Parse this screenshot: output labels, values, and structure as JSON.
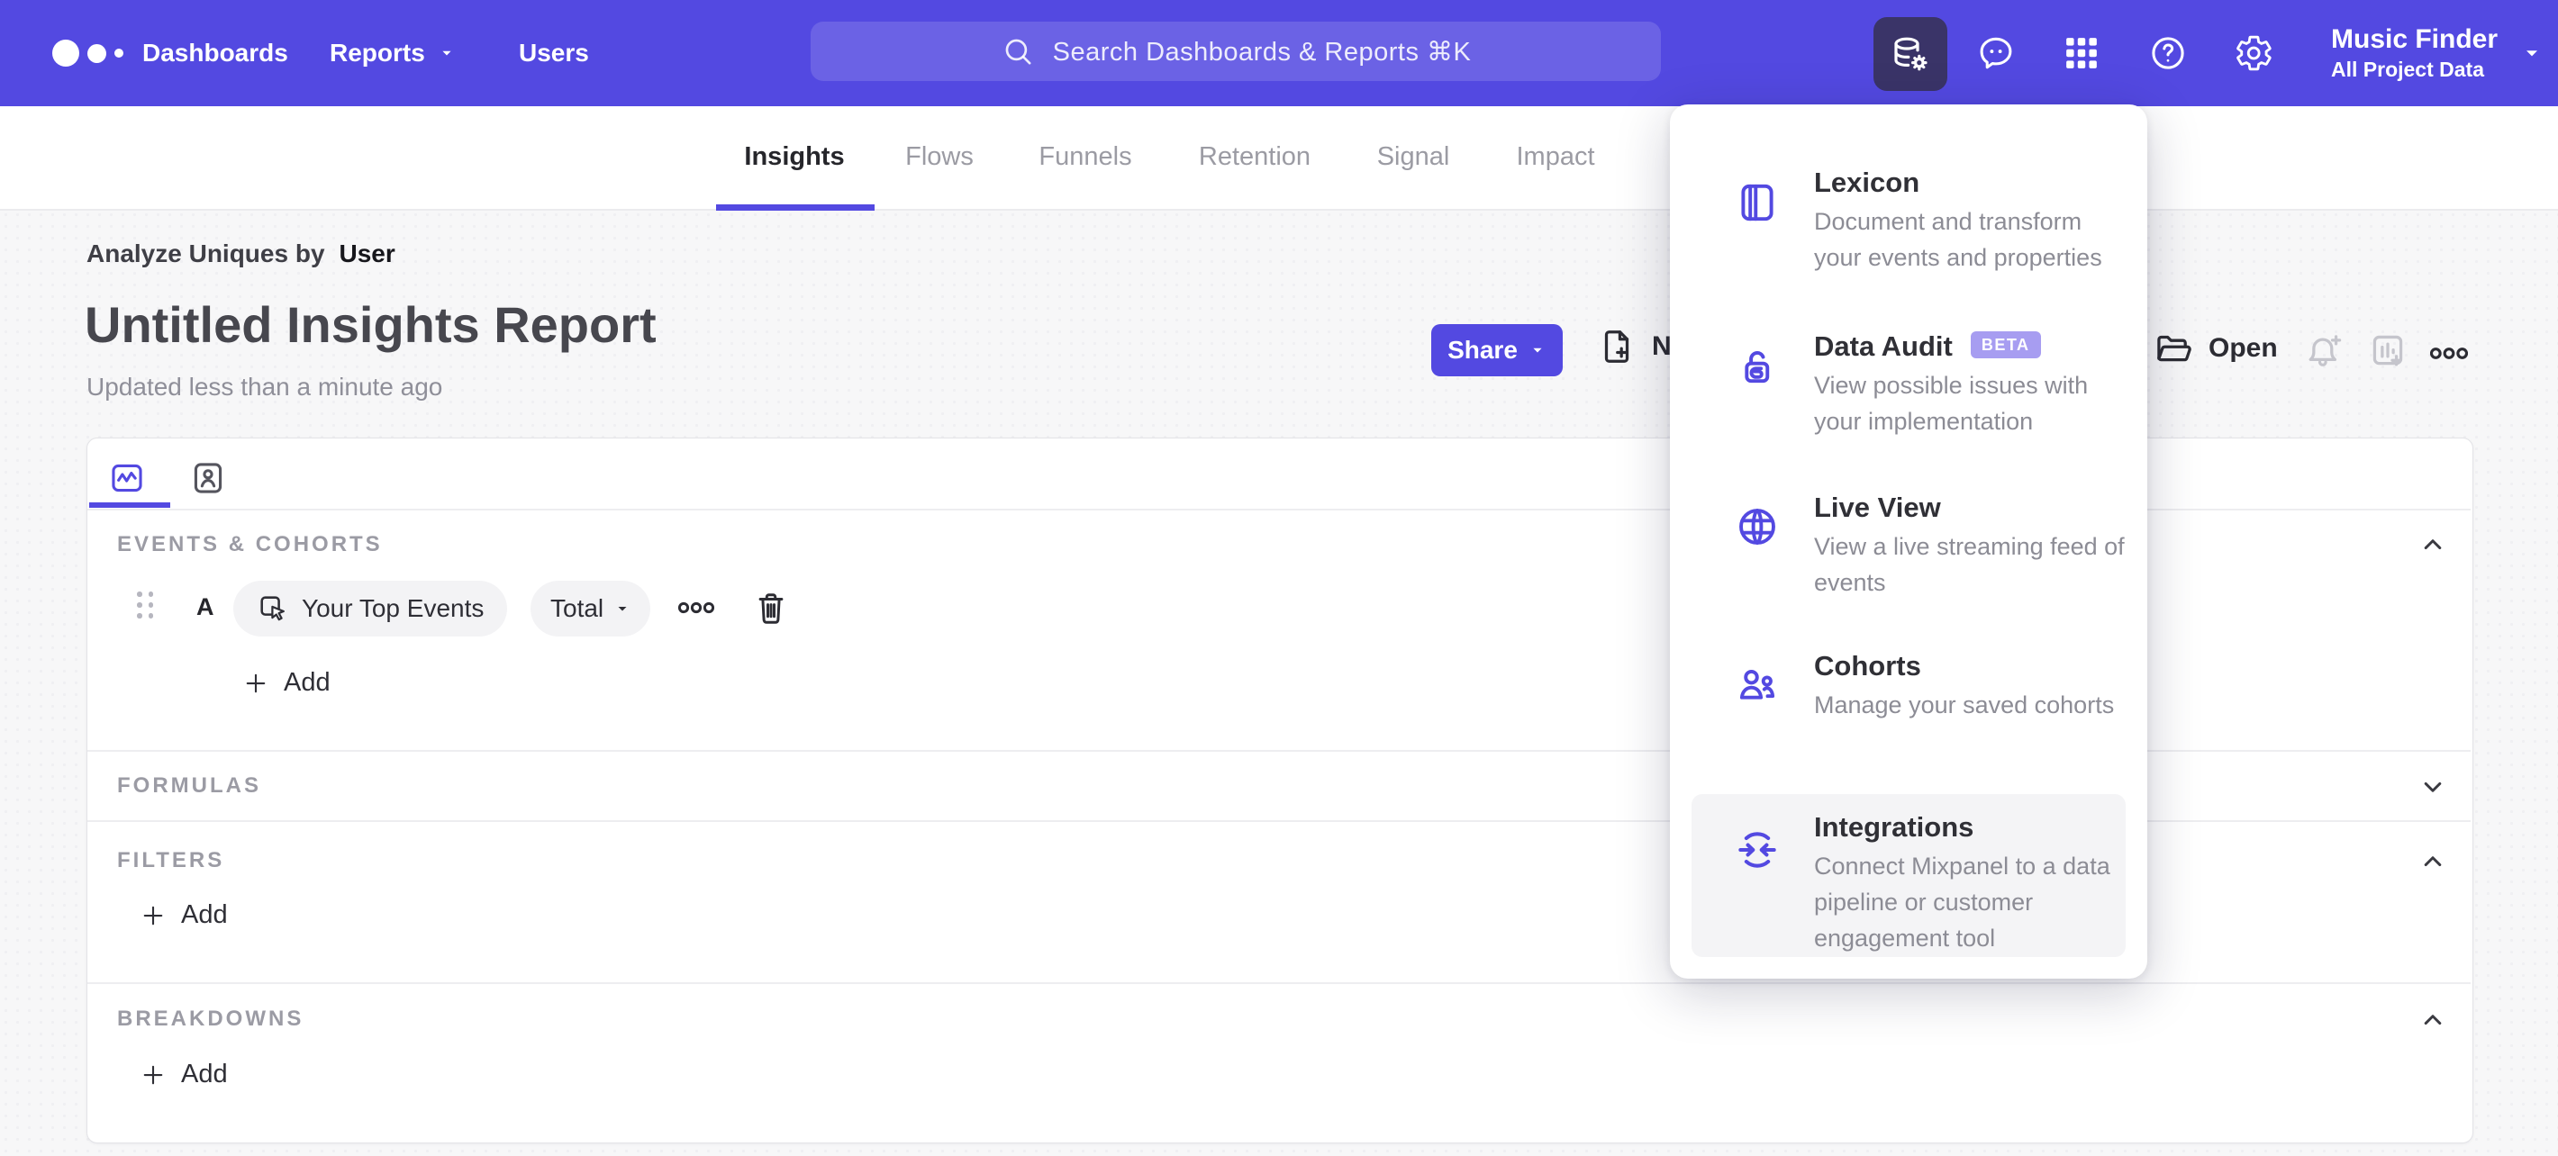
{
  "topnav": {
    "links": [
      {
        "label": "Dashboards"
      },
      {
        "label": "Reports"
      },
      {
        "label": "Users"
      }
    ],
    "search": {
      "placeholder": "Search Dashboards & Reports ⌘K"
    },
    "action_icons": [
      "data-management",
      "feedback",
      "apps-grid",
      "help",
      "settings"
    ],
    "project": {
      "name": "Music Finder",
      "scope": "All Project Data"
    }
  },
  "tabbar": {
    "tabs": [
      {
        "label": "Insights",
        "active": true
      },
      {
        "label": "Flows",
        "active": false
      },
      {
        "label": "Funnels",
        "active": false
      },
      {
        "label": "Retention",
        "active": false
      },
      {
        "label": "Signal",
        "active": false
      },
      {
        "label": "Impact",
        "active": false
      }
    ]
  },
  "report_header": {
    "analyze_prefix": "Analyze Uniques by",
    "analyze_value": "User",
    "title": "Untitled Insights Report",
    "updated": "Updated less than a minute ago",
    "share_label": "Share",
    "new_label_partial": "N",
    "open_label": "Open"
  },
  "builder": {
    "events_header": "EVENTS & COHORTS",
    "event_row": {
      "series_label": "A",
      "event_name": "Your Top Events",
      "aggregation": "Total"
    },
    "add_label": "Add",
    "formulas_header": "FORMULAS",
    "filters_header": "FILTERS",
    "breakdowns_header": "BREAKDOWNS"
  },
  "data_menu": {
    "items": [
      {
        "title": "Lexicon",
        "description": "Document and transform your events and properties"
      },
      {
        "title": "Data Audit",
        "badge": "BETA",
        "description": "View possible issues with your implementation"
      },
      {
        "title": "Live View",
        "description": "View a live streaming feed of events"
      },
      {
        "title": "Cohorts",
        "description": "Manage your saved cohorts"
      },
      {
        "title": "Integrations",
        "description": "Connect Mixpanel to a data pipeline or customer engagement tool",
        "highlighted": true
      }
    ]
  },
  "colors": {
    "nav_purple": "#5349e1",
    "nav_active_tile": "#3a3468",
    "accent_purple": "#5349e1",
    "beta_badge_bg": "#a79df1",
    "page_bg": "#f7f7f8",
    "text_dark": "#2e2e35",
    "text_gray": "#8f8f99",
    "section_header_gray": "#9b9ba4",
    "disabled_icon": "#c5c5cc"
  }
}
